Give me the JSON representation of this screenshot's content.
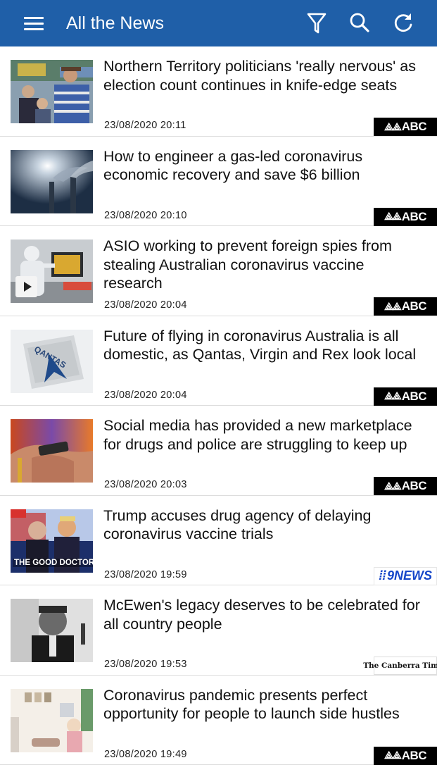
{
  "app_bar": {
    "title": "All the News",
    "background": "#1f5fa8",
    "icons": [
      "menu-icon",
      "filter-icon",
      "search-icon",
      "refresh-icon"
    ]
  },
  "articles": [
    {
      "headline": "Northern Territory politicians 'really nervous' as election count continues in knife-edge seats",
      "timestamp": "23/08/2020 20:11",
      "source": "ABC",
      "thumbnail": "politician-with-family-photo",
      "has_video": false
    },
    {
      "headline": "How to engineer a gas-led coronavirus economic recovery and save $6 billion",
      "timestamp": "23/08/2020 20:10",
      "source": "ABC",
      "thumbnail": "smokestacks-photo",
      "has_video": false
    },
    {
      "headline": "ASIO working to prevent foreign spies from stealing Australian coronavirus vaccine research",
      "timestamp": "23/08/2020 20:04",
      "source": "ABC",
      "thumbnail": "lab-worker-photo",
      "has_video": true
    },
    {
      "headline": "Future of flying in coronavirus Australia is all domestic, as Qantas, Virgin and Rex look local",
      "timestamp": "23/08/2020 20:04",
      "source": "ABC",
      "thumbnail": "qantas-mask-photo",
      "has_video": false
    },
    {
      "headline": "Social media has provided a new marketplace for drugs and police are struggling to keep up",
      "timestamp": "23/08/2020 20:03",
      "source": "ABC",
      "thumbnail": "hands-phone-photo",
      "has_video": false
    },
    {
      "headline": "Trump accuses drug agency of delaying coronavirus vaccine trials",
      "timestamp": "23/08/2020 19:59",
      "source": "9NEWS",
      "thumbnail": "the-good-doctor-photo",
      "thumbnail_text": "THE GOOD DOCTOR",
      "has_video": false
    },
    {
      "headline": "McEwen's legacy deserves to be celebrated for all country people",
      "timestamp": "23/08/2020 19:53",
      "source": "The Canberra Times",
      "thumbnail": "black-white-portrait-photo",
      "has_video": false
    },
    {
      "headline": "Coronavirus pandemic presents perfect opportunity for people to launch side hustles",
      "timestamp": "23/08/2020 19:49",
      "source": "ABC",
      "thumbnail": "home-office-illustration",
      "has_video": false
    }
  ]
}
